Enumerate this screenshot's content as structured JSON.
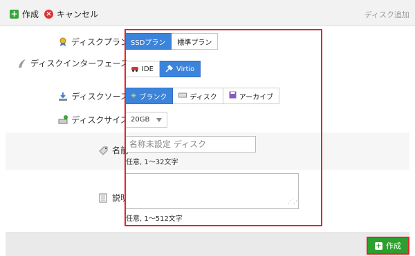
{
  "toolbar": {
    "create_label": "作成",
    "cancel_label": "キャンセル",
    "title": "ディスク追加"
  },
  "form": {
    "plan": {
      "label": "ディスクプラン",
      "options": [
        "SSDプラン",
        "標準プラン"
      ],
      "selected": "SSDプラン"
    },
    "interface": {
      "label": "ディスクインターフェース",
      "options": [
        "IDE",
        "Virtio"
      ],
      "selected": "Virtio"
    },
    "source": {
      "label": "ディスクソース",
      "options": [
        "ブランク",
        "ディスク",
        "アーカイブ"
      ],
      "selected": "ブランク"
    },
    "size": {
      "label": "ディスクサイズ",
      "value": "20GB"
    },
    "name": {
      "label": "名前",
      "placeholder": "名称未設定 ディスク",
      "hint": "任意, 1〜32文字"
    },
    "description": {
      "label": "説明",
      "hint": "任意, 1〜512文字"
    }
  },
  "footer": {
    "create_label": "作成"
  }
}
